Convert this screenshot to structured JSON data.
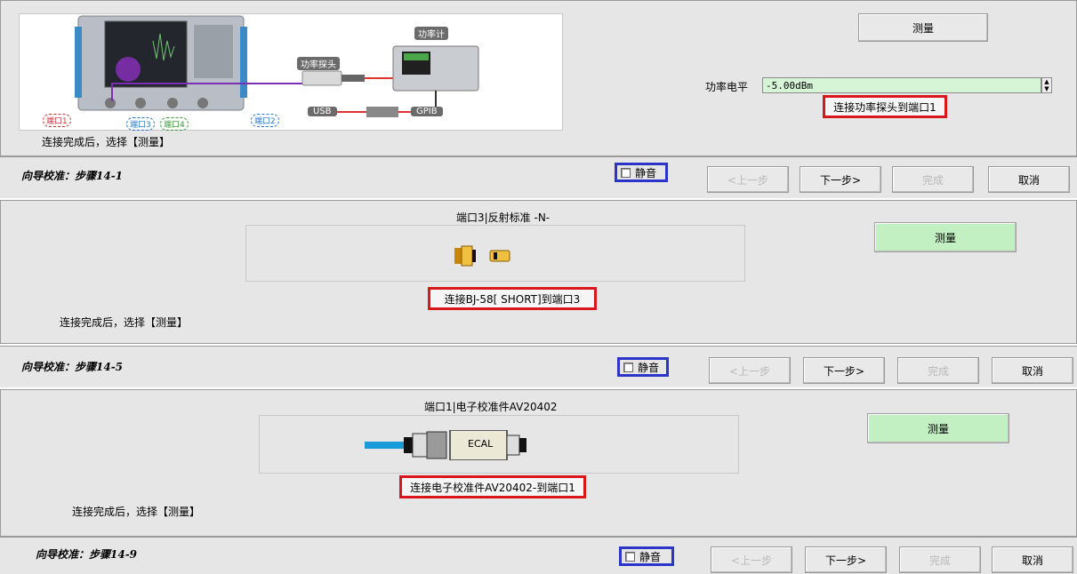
{
  "panel1": {
    "instruction": "连接完成后，选择【测量】",
    "diagram_labels": {
      "power_meter": "功率计",
      "power_probe": "功率探头",
      "usb": "USB",
      "gpib": "GPIB",
      "port1": "端口1",
      "port2": "端口2",
      "port3": "端口3",
      "port4": "端口4"
    },
    "measure_label": "测量",
    "power_level_label": "功率电平",
    "power_level_value": "-5.00dBm",
    "connect_note": "连接功率探头到端口1",
    "step_label": "向导校准：步骤14-1",
    "mute_label": "静音",
    "prev_label": "<上一步",
    "next_label": "下一步>",
    "finish_label": "完成",
    "cancel_label": "取消"
  },
  "panel2": {
    "standard_title": "端口3|反射标准 -N-",
    "instruction": "连接完成后，选择【测量】",
    "measure_label": "测量",
    "connect_note": "连接BJ-58[ SHORT]到端口3",
    "step_label": "向导校准：步骤14-5",
    "mute_label": "静音",
    "prev_label": "<上一步",
    "next_label": "下一步>",
    "finish_label": "完成",
    "cancel_label": "取消"
  },
  "panel3": {
    "standard_title": "端口1|电子校准件AV20402",
    "ecal_label": "ECAL",
    "instruction": "连接完成后，选择【测量】",
    "measure_label": "测量",
    "connect_note": "连接电子校准件AV20402-到端口1",
    "step_label": "向导校准：步骤14-9",
    "mute_label": "静音",
    "prev_label": "<上一步",
    "next_label": "下一步>",
    "finish_label": "完成",
    "cancel_label": "取消"
  },
  "colors": {
    "panel_bg": "#e6e6e6",
    "measure_green": "#c3f0c3",
    "highlight_red": "#d9161c",
    "highlight_blue": "#2b35c7"
  }
}
